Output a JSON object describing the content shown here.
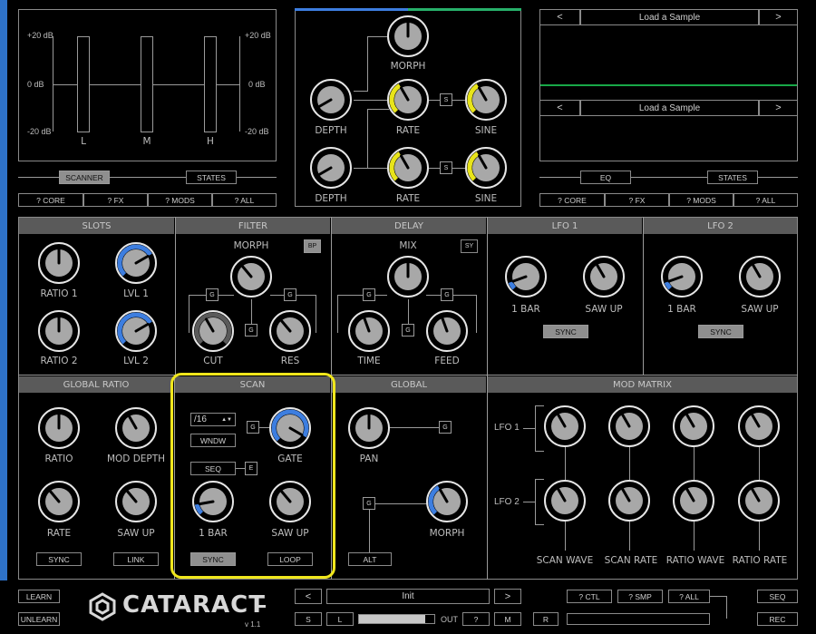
{
  "colors": {
    "accent_blue": "#3d7ee0",
    "accent_yellow": "#e8e41a",
    "highlight": "#f0e61c",
    "green_trace": "#18a848"
  },
  "meters": {
    "db_top": "+20 dB",
    "db_mid": "0 dB",
    "db_bot": "-20 dB",
    "labels": [
      "L",
      "M",
      "H"
    ],
    "tab_left": "SCANNER",
    "tab_right": "STATES",
    "help": [
      "? CORE",
      "? FX",
      "? MODS",
      "? ALL"
    ]
  },
  "lfo_block": {
    "morph": "MORPH",
    "depth": "DEPTH",
    "rate": "RATE",
    "sine": "SINE",
    "s": "S"
  },
  "samples": {
    "prev": "<",
    "next": ">",
    "load1": "Load a Sample",
    "load2": "Load a Sample",
    "tab_left": "EQ",
    "tab_right": "STATES",
    "help": [
      "? CORE",
      "? FX",
      "? MODS",
      "? ALL"
    ]
  },
  "sections": {
    "slots": "SLOTS",
    "filter": "FILTER",
    "delay": "DELAY",
    "lfo1": "LFO 1",
    "lfo2": "LFO 2",
    "global_ratio": "GLOBAL RATIO",
    "scan": "SCAN",
    "global": "GLOBAL",
    "mod_matrix": "MOD MATRIX"
  },
  "slots": {
    "ratio1": "RATIO 1",
    "lvl1": "LVL 1",
    "ratio2": "RATIO 2",
    "lvl2": "LVL 2"
  },
  "filter": {
    "morph": "MORPH",
    "bp": "BP",
    "cut": "CUT",
    "res": "RES",
    "g": "G"
  },
  "delay": {
    "mix": "MIX",
    "sy": "SY",
    "time": "TIME",
    "feed": "FEED",
    "g": "G"
  },
  "lfo1": {
    "bar": "1 BAR",
    "saw": "SAW UP",
    "sync": "SYNC"
  },
  "lfo2": {
    "bar": "1 BAR",
    "saw": "SAW UP",
    "sync": "SYNC"
  },
  "global_ratio": {
    "ratio": "RATIO",
    "mod_depth": "MOD DEPTH",
    "rate": "RATE",
    "saw": "SAW UP",
    "sync": "SYNC",
    "link": "LINK"
  },
  "scan": {
    "division": "/16",
    "wndw": "WNDW",
    "g": "G",
    "gate": "GATE",
    "seq": "SEQ",
    "e": "E",
    "bar": "1 BAR",
    "saw": "SAW UP",
    "sync": "SYNC",
    "loop": "LOOP"
  },
  "global": {
    "pan": "PAN",
    "morph": "MORPH",
    "alt": "ALT",
    "g": "G"
  },
  "mod_matrix": {
    "lfo1": "LFO 1",
    "lfo2": "LFO 2",
    "cols": [
      "SCAN WAVE",
      "SCAN RATE",
      "RATIO WAVE",
      "RATIO RATE"
    ]
  },
  "footer": {
    "learn": "LEARN",
    "unlearn": "UNLEARN",
    "brand": "CATARACT",
    "version": "v 1.1",
    "prev": "<",
    "next": ">",
    "preset": "Init",
    "s": "S",
    "l": "L",
    "out": "OUT",
    "q": "?",
    "m": "M",
    "r": "R",
    "ctl": "? CTL",
    "smp": "? SMP",
    "all": "? ALL",
    "seq": "SEQ",
    "rec": "REC"
  }
}
